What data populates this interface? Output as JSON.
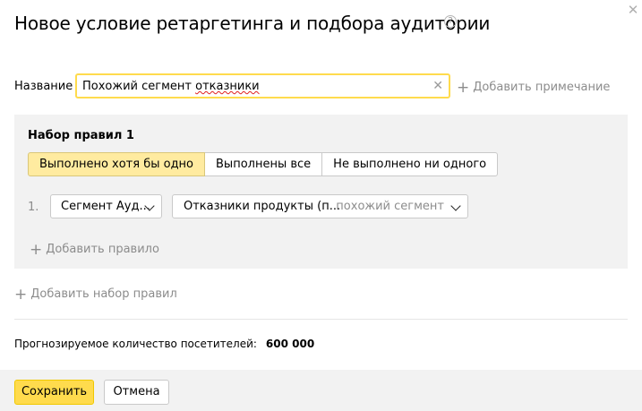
{
  "dialog": {
    "title": "Новое условие ретаргетинга и подбора аудитории",
    "help_icon": "question-circle-icon",
    "close_icon": "close-icon"
  },
  "name": {
    "label": "Название",
    "value_part1": "Похожий сегмент ",
    "value_part2": "отказники",
    "clear_icon": "clear-icon"
  },
  "add_note": {
    "label": "Добавить примечание"
  },
  "ruleset": {
    "title": "Набор правил 1",
    "modes": [
      {
        "label": "Выполнено хотя бы одно",
        "active": true
      },
      {
        "label": "Выполнены все",
        "active": false
      },
      {
        "label": "Не выполнено ни одного",
        "active": false
      }
    ],
    "rules": [
      {
        "number": "1.",
        "type_select": "Сегмент Ауд...",
        "segment_select": "Отказники продукты (п...",
        "segment_hint": "похожий сегмент"
      }
    ],
    "add_rule_label": "Добавить правило"
  },
  "add_ruleset": {
    "label": "Добавить набор правил"
  },
  "forecast": {
    "label": "Прогнозируемое количество посетителей:",
    "value": "600 000"
  },
  "footer": {
    "save_label": "Сохранить",
    "cancel_label": "Отмена"
  },
  "colors": {
    "accent": "#ffdb4d",
    "active_tab": "#ffeba0",
    "panel": "#f2f2f2",
    "muted": "#8c8c8c"
  }
}
